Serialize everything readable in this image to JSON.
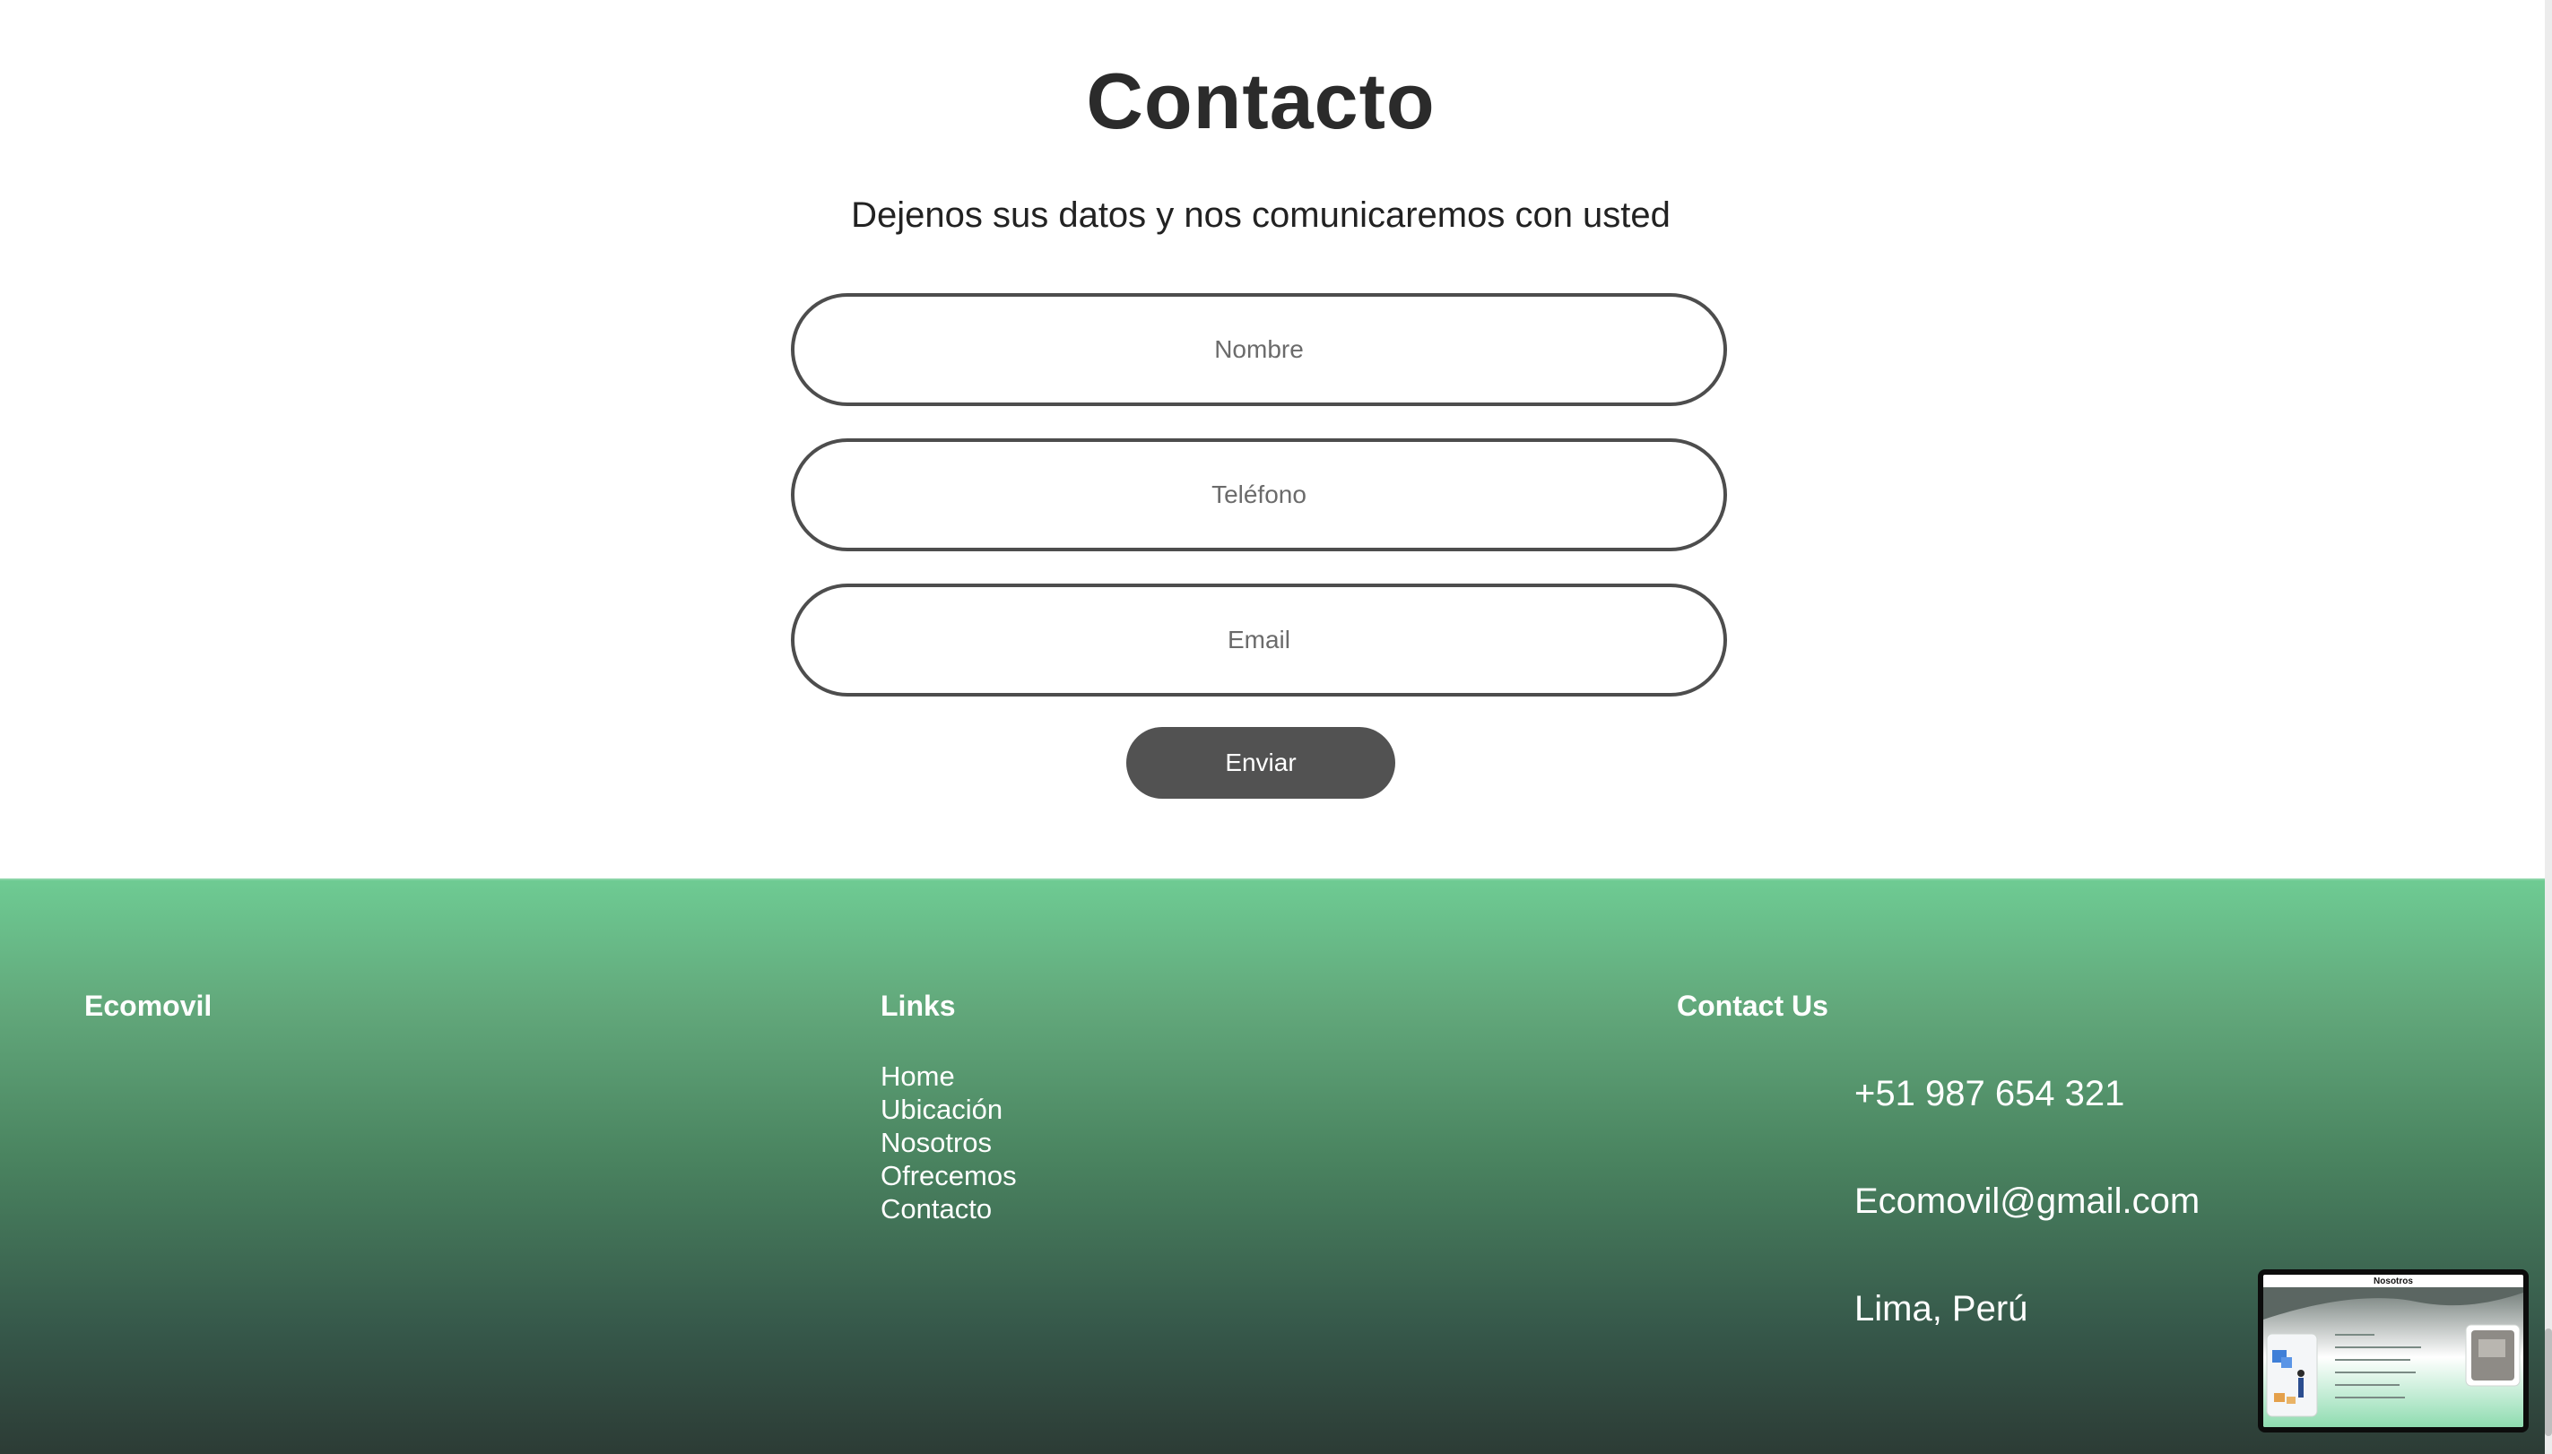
{
  "contact": {
    "title": "Contacto",
    "subtitle": "Dejenos sus datos y nos comunicaremos con usted",
    "fields": {
      "nombre_placeholder": "Nombre",
      "telefono_placeholder": "Teléfono",
      "email_placeholder": "Email"
    },
    "submit_label": "Enviar"
  },
  "footer": {
    "brand": "Ecomovil",
    "links_heading": "Links",
    "links": [
      "Home",
      "Ubicación",
      "Nosotros",
      "Ofrecemos",
      "Contacto"
    ],
    "contact_heading": "Contact Us",
    "phone": "+51 987 654 321",
    "email": "Ecomovil@gmail.com",
    "address": "Lima, Perú"
  },
  "preview": {
    "title": "Nosotros"
  },
  "colors": {
    "button": "#525252",
    "field_border": "#4d4d4d",
    "footer_top": "#6ecb93",
    "footer_bottom": "#2c3b35"
  }
}
